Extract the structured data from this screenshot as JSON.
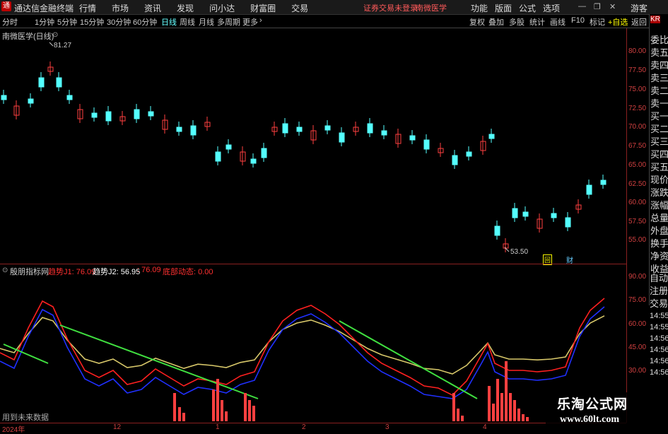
{
  "app": {
    "title": "通达信金融终端",
    "menu": [
      "行情",
      "市场",
      "资讯",
      "发现",
      "问小达",
      "财富圈",
      "交易"
    ],
    "login_warning": "证券交易未登录",
    "stock_name_top": "南微医学",
    "right_menu": [
      "功能",
      "版面",
      "公式",
      "选项"
    ],
    "guest": "游客"
  },
  "periods": [
    "分时",
    "1分钟",
    "5分钟",
    "15分钟",
    "30分钟",
    "60分钟",
    "日线",
    "周线",
    "月线",
    "多周期",
    "更多"
  ],
  "active_period": "日线",
  "tools": [
    "复权",
    "叠加",
    "多股",
    "统计",
    "画线",
    "F10",
    "标记",
    "+自选",
    "返回"
  ],
  "price_panel": {
    "title": "南微医学(日线)",
    "high_marker": "81.27",
    "low_marker": "53.50",
    "badge_a": "回",
    "badge_b": "财"
  },
  "indicator_panel": {
    "name": "殷朋指标网",
    "j1_label": "趋势J1: 76.09",
    "j2_label": "趋势J2: 56.95",
    "extra_value": ": 76.09",
    "bottom_label": "底部动态: 0.00",
    "note": "用到未来数据"
  },
  "price_axis": [
    "80.00",
    "77.50",
    "75.00",
    "72.50",
    "70.00",
    "67.50",
    "65.00",
    "62.50",
    "60.00",
    "57.50",
    "55.00"
  ],
  "indicator_axis": [
    "90.00",
    "75.00",
    "60.00",
    "45.00",
    "30.00"
  ],
  "x_axis": [
    "2024年",
    "12",
    "1",
    "2",
    "3",
    "4"
  ],
  "right_panel": {
    "items": [
      "KR",
      "委比",
      "卖五",
      "卖四",
      "卖三",
      "卖二",
      "卖一",
      "买一",
      "买二",
      "买三",
      "买四",
      "买五",
      "现价",
      "涨跌",
      "涨幅",
      "总量",
      "外盘",
      "换手",
      "净资",
      "收益"
    ],
    "lower": [
      "自动",
      "注册",
      "交易",
      "14:55",
      "14:55",
      "14:56",
      "14:56",
      "14:56",
      "14:56"
    ]
  },
  "watermark": {
    "line1": "乐淘公式网",
    "line2": "www.60lt.com"
  },
  "colors": {
    "up": "#ff4040",
    "down": "#54ffff",
    "j1": "#ff2020",
    "j2": "#2030ff",
    "signal": "#d8c86a",
    "trend": "#40e040",
    "axis": "#d04040"
  }
}
